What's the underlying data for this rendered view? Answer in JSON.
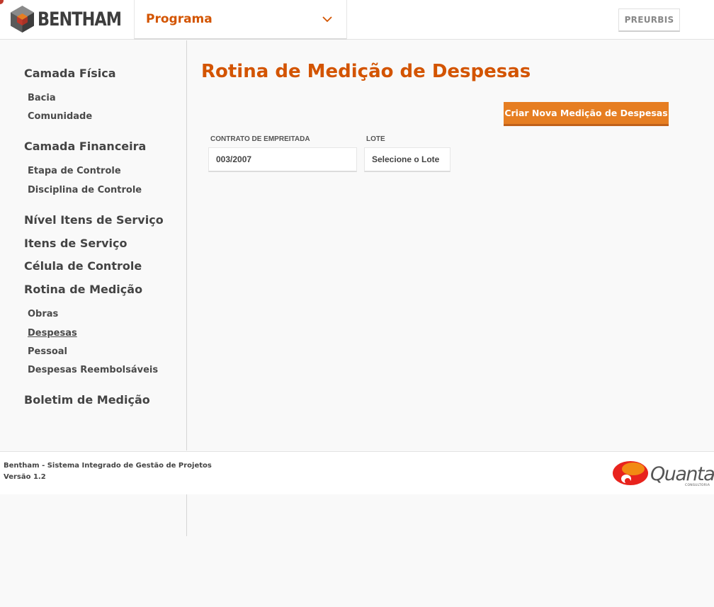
{
  "header": {
    "logo_text": "BENTHAM",
    "program_label": "Programa",
    "user_button": "PREURBIS"
  },
  "sidebar": {
    "camada_fisica": "Camada Física",
    "bacia": "Bacia",
    "comunidade": "Comunidade",
    "camada_financeira": "Camada Financeira",
    "etapa_controle": "Etapa de Controle",
    "disciplina_controle": "Disciplina de Controle",
    "nivel_itens": "Nível Itens de Serviço",
    "itens_servico": "Itens de Serviço",
    "celula_controle": "Célula de Controle",
    "rotina_medicao": "Rotina de Medição",
    "obras": "Obras",
    "despesas": "Despesas",
    "pessoal": "Pessoal",
    "despesas_reembolsaveis": "Despesas Reembolsáveis",
    "boletim_medicao": "Boletim de Medição"
  },
  "main": {
    "title": "Rotina de Medição de Despesas",
    "create_button": "Criar Nova Medição de Despesas",
    "contrato_label": "CONTRATO DE EMPREITADA",
    "contrato_value": "003/2007",
    "lote_label": "LOTE",
    "lote_value": "Selecione o Lote"
  },
  "footer": {
    "system_name": "Bentham - Sistema Integrado de Gestão de Projetos",
    "version": "Versão 1.2",
    "partner_logo_name": "Quanta",
    "partner_logo_sub": "CONSULTORIA"
  },
  "colors": {
    "accent": "#d35400",
    "button": "#e67e22"
  }
}
